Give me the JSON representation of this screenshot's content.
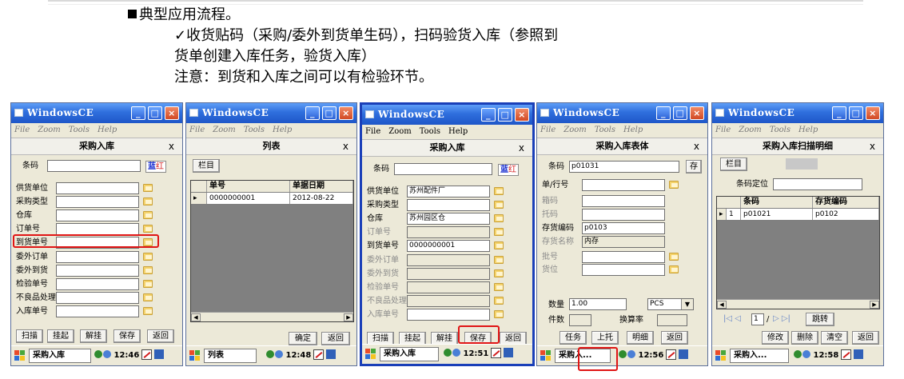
{
  "doc": {
    "heading": "典型应用流程。",
    "check": "✓",
    "line2": "收货贴码（采购/委外到货单生码），扫码验货入库（参照到",
    "line3": "货单创建入库任务，验货入库）",
    "line4": "注意：到货和入库之间可以有检验环节。"
  },
  "common": {
    "window_title": "WindowsCE",
    "menu": [
      "File",
      "Zoom",
      "Tools",
      "Help"
    ],
    "min": "_",
    "max": "□",
    "close": "×",
    "form_close": "x",
    "chip_blue": "蓝",
    "chip_red": "红"
  },
  "screen1": {
    "form_title": "采购入库",
    "barcode_label": "条码",
    "fields": [
      "供货单位",
      "采购类型",
      "仓库",
      "订单号",
      "到货单号",
      "委外订单",
      "委外到货",
      "检验单号",
      "不良品处理",
      "入库单号"
    ],
    "buttons": [
      "扫描",
      "挂起",
      "解挂",
      "保存",
      "返回"
    ],
    "task": "采购入库",
    "time": "12:46"
  },
  "screen2": {
    "form_title": "列表",
    "column_button": "栏目",
    "columns": [
      "单号",
      "单据日期"
    ],
    "rows": [
      {
        "no": "0000000001",
        "date": "2012-08-22"
      }
    ],
    "buttons": [
      "确定",
      "返回"
    ],
    "task": "列表",
    "time": "12:48"
  },
  "screen3": {
    "form_title": "采购入库",
    "barcode_label": "条码",
    "fields": [
      "供货单位",
      "采购类型",
      "仓库",
      "订单号",
      "到货单号",
      "委外订单",
      "委外到货",
      "检验单号",
      "不良品处理",
      "入库单号"
    ],
    "values": {
      "supplier": "苏州配件厂",
      "warehouse": "苏州园区仓",
      "arrival_no": "0000000001"
    },
    "buttons": [
      "扫描",
      "挂起",
      "解挂",
      "保存",
      "返回"
    ],
    "task": "采购入库",
    "time": "12:51"
  },
  "screen4": {
    "form_title": "采购入库表体",
    "barcode_label": "条码",
    "barcode_value": "p01031",
    "save_btn": "存",
    "fields": [
      "单/行号",
      "箱码",
      "托码",
      "存货编码",
      "存货名称",
      "批号",
      "货位"
    ],
    "inv_code": "p0103",
    "inv_name": "内存",
    "qty_label": "数量",
    "qty_value": "1.00",
    "unit_value": "PCS",
    "pieces_label": "件数",
    "rate_label": "换算率",
    "buttons": [
      "任务",
      "上托",
      "明细",
      "返回"
    ],
    "task": "采购入...",
    "time": "12:56"
  },
  "screen5": {
    "form_title": "采购入库扫描明细",
    "column_button": "栏目",
    "locate_label": "条码定位",
    "columns": [
      "条码",
      "存货编码"
    ],
    "rows": [
      {
        "idx": "1",
        "code": "p01021",
        "inv": "p0102"
      }
    ],
    "page_value": "1",
    "page_total": "/",
    "jump_btn": "跳转",
    "buttons": [
      "修改",
      "删除",
      "清空",
      "返回"
    ],
    "task": "采购入...",
    "time": "12:58"
  }
}
